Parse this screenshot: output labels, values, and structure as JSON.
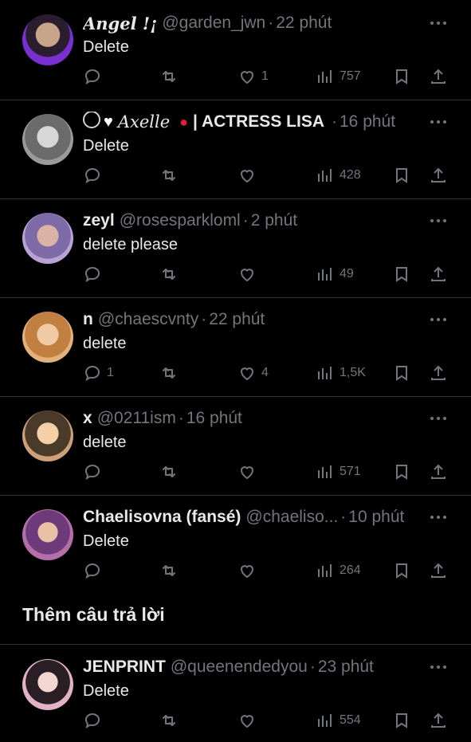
{
  "tweets": [
    {
      "name": "Angel !¡",
      "handle": "@garden_jwn",
      "time": "22 phút",
      "text": "Delete",
      "reply": "",
      "like": "1",
      "views": "757",
      "avatar": "#7a2fd0"
    },
    {
      "name": "| ACTRESS LISA",
      "name_prefix": "Axelle",
      "handle": "",
      "time": "16 phút",
      "text": "Delete",
      "reply": "",
      "like": "",
      "views": "428",
      "avatar": "#888888"
    },
    {
      "name": "zeyl",
      "handle": "@rosesparkloml",
      "time": "2 phút",
      "text": "delete please",
      "reply": "",
      "like": "",
      "views": "49",
      "avatar": "#b8a2d6"
    },
    {
      "name": "n",
      "handle": "@chaescvnty",
      "time": "22 phút",
      "text": "delete",
      "reply": "1",
      "like": "4",
      "views": "1,5K",
      "avatar": "#d7a36a"
    },
    {
      "name": "x",
      "handle": "@0211ism",
      "time": "16 phút",
      "text": "delete",
      "reply": "",
      "like": "",
      "views": "571",
      "avatar": "#cda07a"
    },
    {
      "name": "Chaelisovna (fansé)",
      "handle": "@chaeliso...",
      "time": "10 phút",
      "text": "Delete",
      "reply": "",
      "like": "",
      "views": "264",
      "avatar": "#b46ea8"
    },
    {
      "name": "JENPRINT",
      "handle": "@queenendedyou",
      "time": "23 phút",
      "text": "Delete",
      "reply": "",
      "like": "",
      "views": "554",
      "avatar": "#e2b3c6"
    }
  ],
  "section_title": "Thêm câu trả lời",
  "colors": {
    "background": "#000000",
    "text": "#e7e9ea",
    "muted": "#71767b",
    "divider": "#2f3336"
  },
  "icons": [
    "reply-icon",
    "retweet-icon",
    "like-icon",
    "views-icon",
    "bookmark-icon",
    "share-icon",
    "more-icon"
  ]
}
